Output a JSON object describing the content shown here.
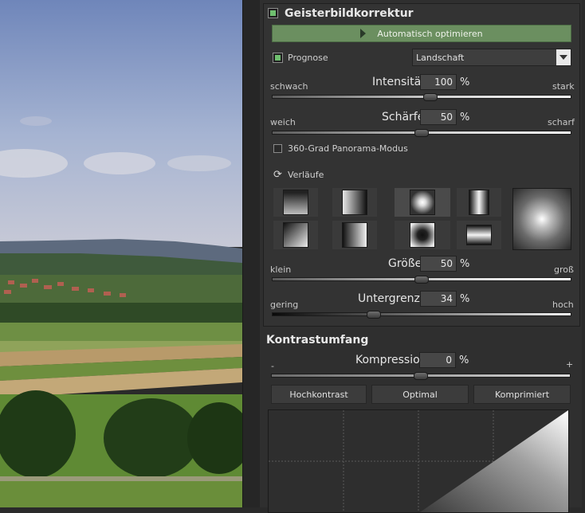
{
  "ghost": {
    "title": "Geisterbildkorrektur",
    "auto_button": "Automatisch optimieren",
    "prognose_label": "Prognose",
    "prognose_select": "Landschaft",
    "intensity": {
      "label": "Intensität",
      "value": "100",
      "unit": "%",
      "min_label": "schwach",
      "max_label": "stark",
      "level": 0.53
    },
    "sharpness": {
      "label": "Schärfe",
      "value": "50",
      "unit": "%",
      "min_label": "weich",
      "max_label": "scharf",
      "level": 0.5
    },
    "panorama_label": "360-Grad Panorama-Modus",
    "gradients_label": "Verläufe",
    "size": {
      "label": "Größe",
      "value": "50",
      "unit": "%",
      "min_label": "klein",
      "max_label": "groß",
      "level": 0.5
    },
    "lower_limit": {
      "label": "Untergrenze",
      "value": "34",
      "unit": "%",
      "min_label": "gering",
      "max_label": "hoch",
      "level": 0.34
    }
  },
  "contrast": {
    "title": "Kontrastumfang",
    "compression": {
      "label": "Kompression",
      "value": "0",
      "unit": "%",
      "min_label": "-",
      "max_label": "+",
      "level": 0.5
    },
    "buttons": [
      "Hochkontrast",
      "Optimal",
      "Komprimiert"
    ]
  },
  "colors": {
    "accent_green": "#6b8f60",
    "panel_bg": "#333333"
  }
}
